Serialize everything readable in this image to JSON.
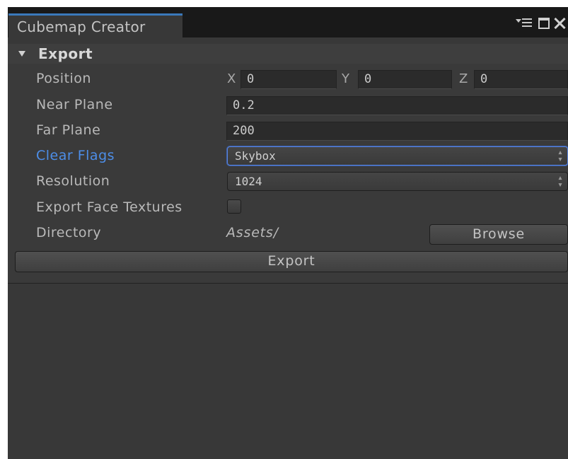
{
  "window": {
    "tab_title": "Cubemap Creator",
    "icons": [
      "menu-icon",
      "maximize-icon",
      "close-icon"
    ]
  },
  "section": {
    "title": "Export",
    "expanded": true
  },
  "fields": {
    "position": {
      "label": "Position",
      "x_label": "X",
      "x_value": "0",
      "y_label": "Y",
      "y_value": "0",
      "z_label": "Z",
      "z_value": "0"
    },
    "near_plane": {
      "label": "Near Plane",
      "value": "0.2"
    },
    "far_plane": {
      "label": "Far Plane",
      "value": "200"
    },
    "clear_flags": {
      "label": "Clear Flags",
      "value": "Skybox",
      "focused": true
    },
    "resolution": {
      "label": "Resolution",
      "value": "1024"
    },
    "export_face_textures": {
      "label": "Export Face Textures",
      "checked": false
    },
    "directory": {
      "label": "Directory",
      "value": "Assets/",
      "browse_label": "Browse"
    }
  },
  "export_button": {
    "label": "Export"
  },
  "colors": {
    "accent": "#3a79bb",
    "active_label": "#4d8ee8",
    "panel_bg": "#383838"
  }
}
